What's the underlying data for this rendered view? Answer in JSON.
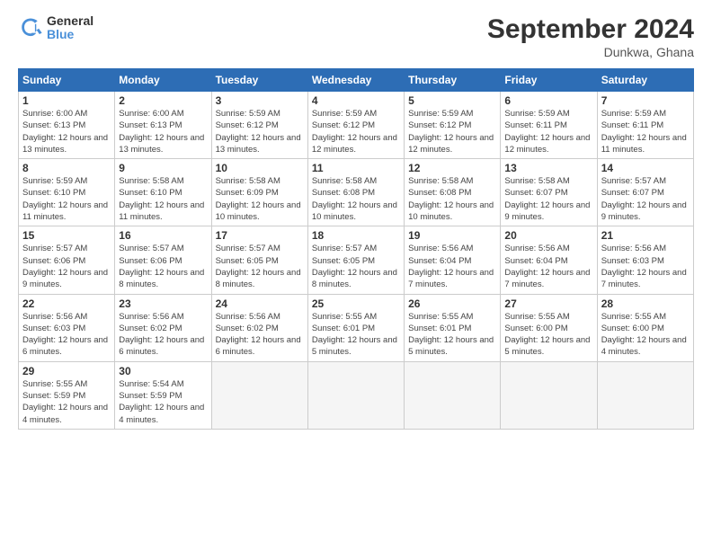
{
  "title": "September 2024",
  "subtitle": "Dunkwa, Ghana",
  "logo": {
    "line1": "General",
    "line2": "Blue"
  },
  "days_of_week": [
    "Sunday",
    "Monday",
    "Tuesday",
    "Wednesday",
    "Thursday",
    "Friday",
    "Saturday"
  ],
  "weeks": [
    [
      {
        "day": "1",
        "sunrise": "6:00 AM",
        "sunset": "6:13 PM",
        "daylight": "12 hours and 13 minutes."
      },
      {
        "day": "2",
        "sunrise": "6:00 AM",
        "sunset": "6:13 PM",
        "daylight": "12 hours and 13 minutes."
      },
      {
        "day": "3",
        "sunrise": "5:59 AM",
        "sunset": "6:12 PM",
        "daylight": "12 hours and 13 minutes."
      },
      {
        "day": "4",
        "sunrise": "5:59 AM",
        "sunset": "6:12 PM",
        "daylight": "12 hours and 12 minutes."
      },
      {
        "day": "5",
        "sunrise": "5:59 AM",
        "sunset": "6:12 PM",
        "daylight": "12 hours and 12 minutes."
      },
      {
        "day": "6",
        "sunrise": "5:59 AM",
        "sunset": "6:11 PM",
        "daylight": "12 hours and 12 minutes."
      },
      {
        "day": "7",
        "sunrise": "5:59 AM",
        "sunset": "6:11 PM",
        "daylight": "12 hours and 11 minutes."
      }
    ],
    [
      {
        "day": "8",
        "sunrise": "5:59 AM",
        "sunset": "6:10 PM",
        "daylight": "12 hours and 11 minutes."
      },
      {
        "day": "9",
        "sunrise": "5:58 AM",
        "sunset": "6:10 PM",
        "daylight": "12 hours and 11 minutes."
      },
      {
        "day": "10",
        "sunrise": "5:58 AM",
        "sunset": "6:09 PM",
        "daylight": "12 hours and 10 minutes."
      },
      {
        "day": "11",
        "sunrise": "5:58 AM",
        "sunset": "6:08 PM",
        "daylight": "12 hours and 10 minutes."
      },
      {
        "day": "12",
        "sunrise": "5:58 AM",
        "sunset": "6:08 PM",
        "daylight": "12 hours and 10 minutes."
      },
      {
        "day": "13",
        "sunrise": "5:58 AM",
        "sunset": "6:07 PM",
        "daylight": "12 hours and 9 minutes."
      },
      {
        "day": "14",
        "sunrise": "5:57 AM",
        "sunset": "6:07 PM",
        "daylight": "12 hours and 9 minutes."
      }
    ],
    [
      {
        "day": "15",
        "sunrise": "5:57 AM",
        "sunset": "6:06 PM",
        "daylight": "12 hours and 9 minutes."
      },
      {
        "day": "16",
        "sunrise": "5:57 AM",
        "sunset": "6:06 PM",
        "daylight": "12 hours and 8 minutes."
      },
      {
        "day": "17",
        "sunrise": "5:57 AM",
        "sunset": "6:05 PM",
        "daylight": "12 hours and 8 minutes."
      },
      {
        "day": "18",
        "sunrise": "5:57 AM",
        "sunset": "6:05 PM",
        "daylight": "12 hours and 8 minutes."
      },
      {
        "day": "19",
        "sunrise": "5:56 AM",
        "sunset": "6:04 PM",
        "daylight": "12 hours and 7 minutes."
      },
      {
        "day": "20",
        "sunrise": "5:56 AM",
        "sunset": "6:04 PM",
        "daylight": "12 hours and 7 minutes."
      },
      {
        "day": "21",
        "sunrise": "5:56 AM",
        "sunset": "6:03 PM",
        "daylight": "12 hours and 7 minutes."
      }
    ],
    [
      {
        "day": "22",
        "sunrise": "5:56 AM",
        "sunset": "6:03 PM",
        "daylight": "12 hours and 6 minutes."
      },
      {
        "day": "23",
        "sunrise": "5:56 AM",
        "sunset": "6:02 PM",
        "daylight": "12 hours and 6 minutes."
      },
      {
        "day": "24",
        "sunrise": "5:56 AM",
        "sunset": "6:02 PM",
        "daylight": "12 hours and 6 minutes."
      },
      {
        "day": "25",
        "sunrise": "5:55 AM",
        "sunset": "6:01 PM",
        "daylight": "12 hours and 5 minutes."
      },
      {
        "day": "26",
        "sunrise": "5:55 AM",
        "sunset": "6:01 PM",
        "daylight": "12 hours and 5 minutes."
      },
      {
        "day": "27",
        "sunrise": "5:55 AM",
        "sunset": "6:00 PM",
        "daylight": "12 hours and 5 minutes."
      },
      {
        "day": "28",
        "sunrise": "5:55 AM",
        "sunset": "6:00 PM",
        "daylight": "12 hours and 4 minutes."
      }
    ],
    [
      {
        "day": "29",
        "sunrise": "5:55 AM",
        "sunset": "5:59 PM",
        "daylight": "12 hours and 4 minutes."
      },
      {
        "day": "30",
        "sunrise": "5:54 AM",
        "sunset": "5:59 PM",
        "daylight": "12 hours and 4 minutes."
      },
      null,
      null,
      null,
      null,
      null
    ]
  ]
}
